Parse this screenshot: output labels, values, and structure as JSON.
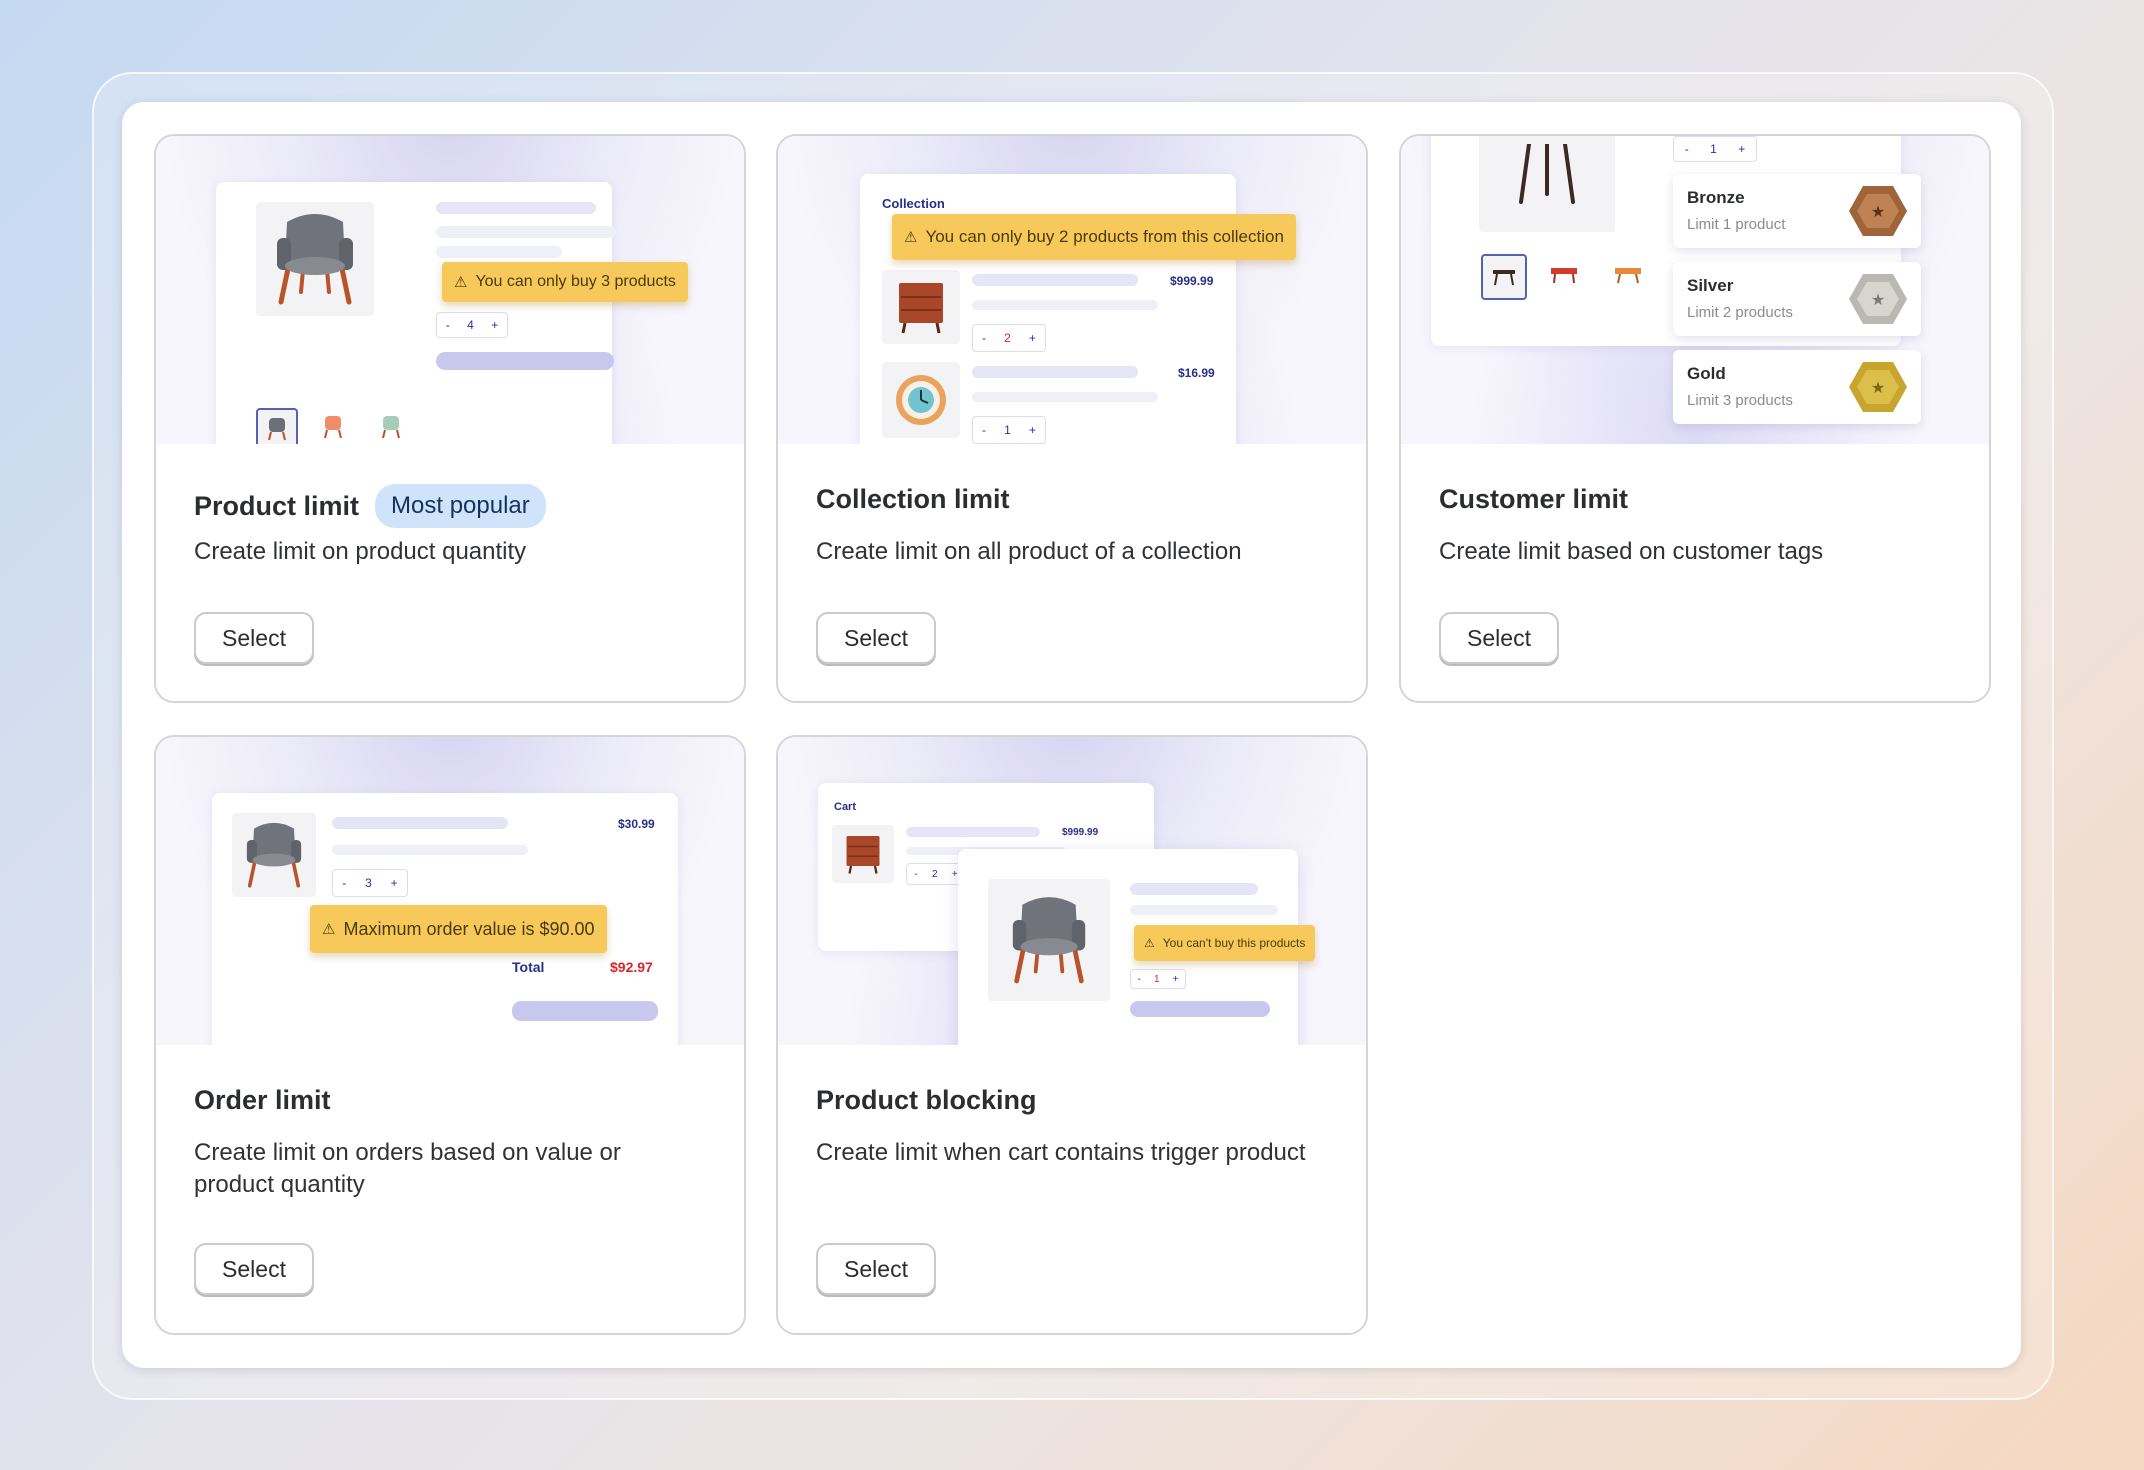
{
  "cards": [
    {
      "title": "Product limit",
      "badge": "Most popular",
      "description": "Create limit on product quantity",
      "button": "Select",
      "preview": {
        "warning": "You can only buy 3 products",
        "qty": [
          "-",
          "4",
          "+"
        ]
      }
    },
    {
      "title": "Collection limit",
      "description": "Create limit on all product of a collection",
      "button": "Select",
      "preview": {
        "heading": "Collection",
        "warning": "You can only buy 2 products from this collection",
        "price1": "$999.99",
        "price2": "$16.99",
        "qty1": [
          "-",
          "2",
          "+"
        ],
        "qty2": [
          "-",
          "1",
          "+"
        ]
      }
    },
    {
      "title": "Customer limit",
      "description": "Create limit based on customer tags",
      "button": "Select",
      "preview": {
        "qty": [
          "-",
          "1",
          "+"
        ],
        "tiers": [
          {
            "name": "Bronze",
            "limit": "Limit 1 product",
            "color": "#a0643a"
          },
          {
            "name": "Silver",
            "limit": "Limit 2 products",
            "color": "#b9b8b2"
          },
          {
            "name": "Gold",
            "limit": "Limit 3 products",
            "color": "#c8a62e"
          }
        ]
      }
    },
    {
      "title": "Order limit",
      "description": "Create limit on orders based on value or product quantity",
      "button": "Select",
      "preview": {
        "price": "$30.99",
        "qty": [
          "-",
          "3",
          "+"
        ],
        "warning": "Maximum order value is $90.00",
        "total_label": "Total",
        "total_value": "$92.97"
      }
    },
    {
      "title": "Product blocking",
      "description": "Create limit when cart contains trigger product",
      "button": "Select",
      "preview": {
        "heading": "Cart",
        "price": "$999.99",
        "qty1": [
          "-",
          "2",
          "+"
        ],
        "qty2": [
          "-",
          "1",
          "+"
        ],
        "warning": "You can't buy this products"
      }
    }
  ],
  "colors": {
    "warning": "#f7c95a",
    "badge_bg": "#cfe4fb",
    "accent_text": "#27308a",
    "total_red": "#d6262b"
  }
}
